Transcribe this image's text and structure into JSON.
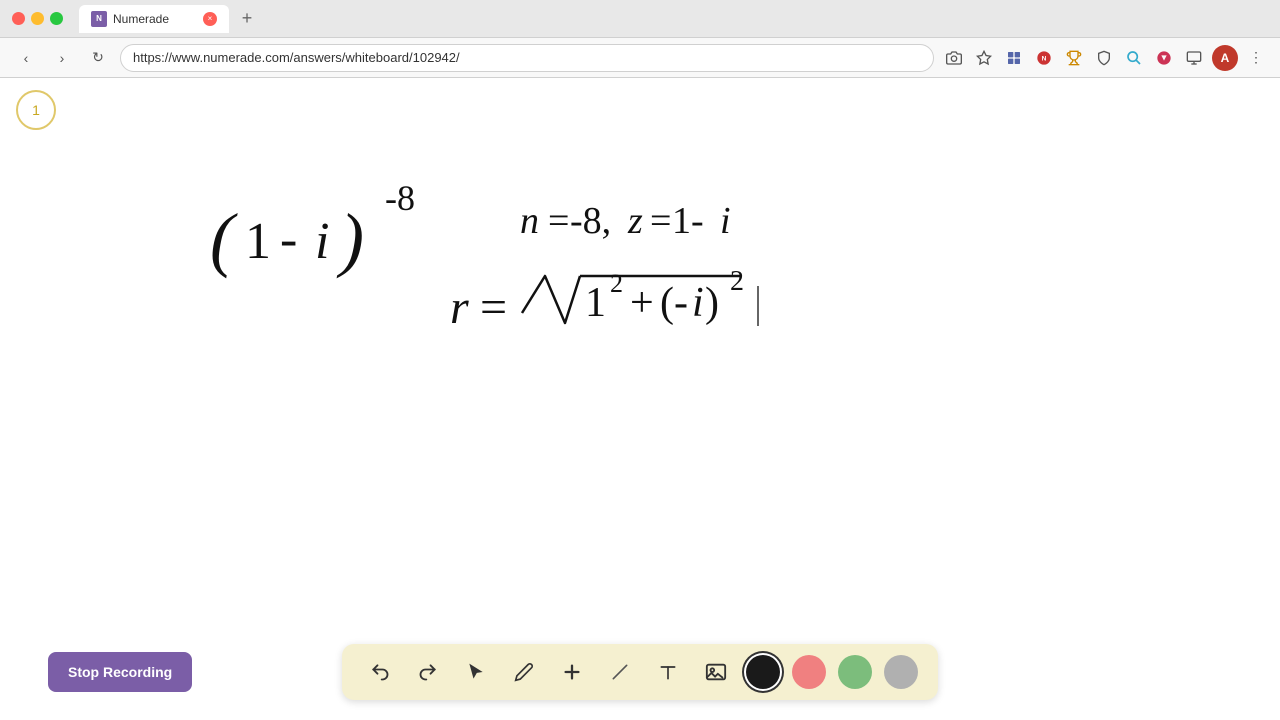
{
  "browser": {
    "title": "Numerade",
    "url": "https://www.numerade.com/answers/whiteboard/102942/",
    "tab_label": "Numerade",
    "new_tab_symbol": "+",
    "tab_close_symbol": "×"
  },
  "nav": {
    "back": "‹",
    "forward": "›",
    "refresh": "↻",
    "profile_initial": "A"
  },
  "page": {
    "page_number": "1"
  },
  "toolbar": {
    "undo": "↩",
    "redo": "↪",
    "cursor": "↖",
    "pen": "✏",
    "add": "+",
    "eraser": "/",
    "text": "A",
    "image": "🖼",
    "colors": [
      "#1a1a1a",
      "#f08080",
      "#90c090",
      "#c0c0c0"
    ]
  },
  "stop_recording": {
    "label": "Stop Recording"
  }
}
